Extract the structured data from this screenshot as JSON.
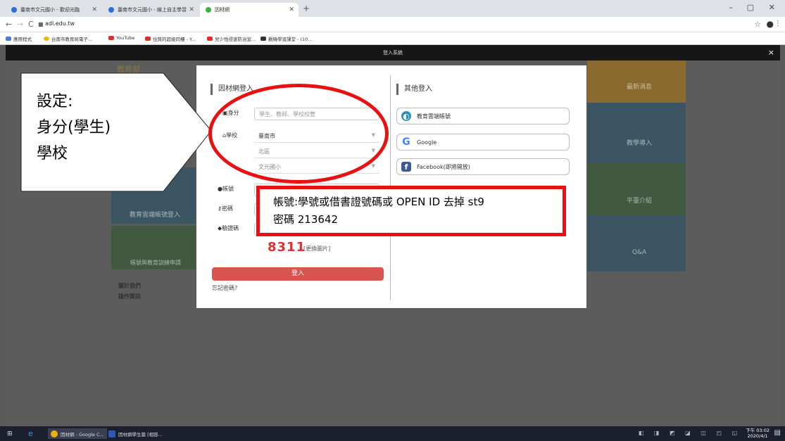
{
  "browser": {
    "tabs": [
      {
        "label": "臺南市文元國小 - 歡迎光臨"
      },
      {
        "label": "臺南市文元國小 - 線上自主學習"
      },
      {
        "label": "因材網"
      }
    ],
    "new_tab": "+",
    "window_controls": [
      "–",
      "▢",
      "✕"
    ],
    "url": "adl.edu.tw",
    "bookmarks": [
      {
        "label": "應用程式"
      },
      {
        "label": "台南市教育局電子..."
      },
      {
        "label": "YouTube"
      },
      {
        "label": "住質的超級同樓 - Y..."
      },
      {
        "label": "兒少性侵害防治宣..."
      },
      {
        "label": "觀韓學習課堂 - (10..."
      }
    ]
  },
  "site": {
    "bar_title": "登入系統",
    "close": "×",
    "bg_tiles": {
      "top_logo": "教育部",
      "t1": "最新消息",
      "t2": "教學導入",
      "t3": "平臺介紹",
      "t4": "Q&A",
      "t5": "教育雲端帳號登入",
      "t6": "帳號與教育訓練申請"
    },
    "footer": {
      "about": "關於我們",
      "ops": "操作資訊"
    }
  },
  "modal": {
    "left_title": "因材網登入",
    "identity_label": "身分",
    "identity_placeholder": "學生、教師、學校校管",
    "school_label": "學校",
    "city_value": "臺南市",
    "district_value": "北區",
    "school_value": "文元國小",
    "account_label": "帳號",
    "password_label": "密碼",
    "captcha_label": "驗證碼",
    "captcha_code": "8311",
    "refresh_label": "[更換圖片]",
    "login_button": "登入",
    "forgot_link": "忘記密碼?",
    "right_title": "其他登入",
    "alt_logins": [
      {
        "label": "教育雲端帳號"
      },
      {
        "label": "Google"
      },
      {
        "label": "Facebook(即將開放)"
      }
    ]
  },
  "annotations": {
    "callout_lines": [
      "設定:",
      "身分(學生)",
      "學校"
    ],
    "box_lines": [
      "帳號:學號或借書證號碼或 OPEN ID 去掉 st9",
      "密碼 213642"
    ],
    "accent_color": "#e81010"
  },
  "taskbar": {
    "apps": [
      {
        "label": "因材網 - Google C..."
      },
      {
        "label": "因材網學生篇 [相容..."
      }
    ],
    "time": "下午 03:02",
    "date": "2020/4/1"
  }
}
